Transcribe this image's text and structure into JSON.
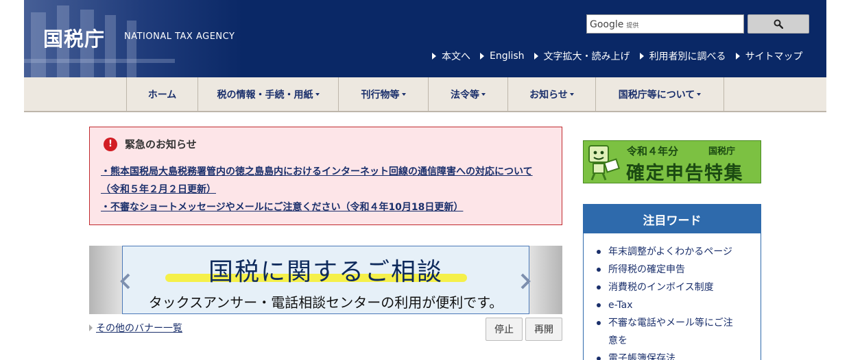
{
  "header": {
    "logo": "国税庁",
    "logo_en": "NATIONAL TAX AGENCY",
    "search": {
      "brand": "Google",
      "provided": "提供",
      "button_icon": "search-icon"
    },
    "util_nav": [
      "本文へ",
      "English",
      "文字拡大・読み上げ",
      "利用者別に調べる",
      "サイトマップ"
    ]
  },
  "global_nav": [
    "ホーム",
    "税の情報・手続・用紙",
    "刊行物等",
    "法令等",
    "お知らせ",
    "国税庁等について"
  ],
  "notice": {
    "title": "緊急のお知らせ",
    "links": [
      "・熊本国税局大島税務署管内の徳之島島内におけるインターネット回線の通信障害への対応について",
      "（令和５年２月２日更新）",
      "・不審なショートメッセージやメールにご注意ください（令和４年10月18日更新）"
    ]
  },
  "banner": {
    "title": "国税に関するご相談",
    "subtitle": "タックスアンサー・電話相談センターの利用が便利です。"
  },
  "banner_list_link": "その他のバナー一覧",
  "controls": {
    "stop": "停止",
    "play": "再開"
  },
  "kakutei": {
    "year": "令和４年分",
    "nta": "国税庁",
    "title": "確定申告特集"
  },
  "keywords": {
    "title": "注目ワード",
    "items": [
      "年末調整がよくわかるページ",
      "所得税の確定申告",
      "消費税のインボイス制度",
      "e-Tax",
      "不審な電話やメール等にご注",
      "意を",
      "電子帳簿保存法"
    ]
  },
  "colors": {
    "header_bg": "#0a2866",
    "nav_bg": "#ede8e0",
    "notice_bg": "#fde5e8",
    "notice_border": "#c0282d",
    "keyword_head": "#2e6aac",
    "kakutei_green": "#7cc142"
  }
}
